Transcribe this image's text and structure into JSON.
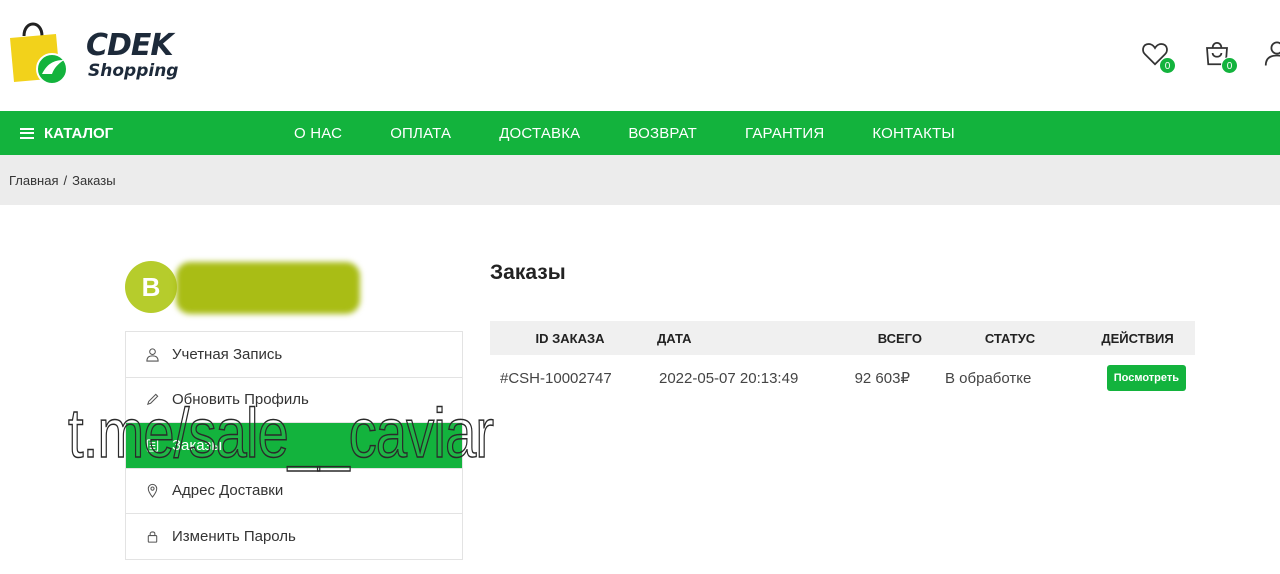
{
  "brand": {
    "name": "CDEK",
    "sub": "Shopping",
    "colors": {
      "primary": "#13b33d",
      "bag": "#f2d21b",
      "avatar": "#b6cc2c"
    }
  },
  "header": {
    "wishlist_count": "0",
    "cart_count": "0",
    "icons": [
      "heart-icon",
      "bag-icon",
      "user-icon"
    ]
  },
  "nav": {
    "catalog_label": "КАТАЛОГ",
    "items": [
      "О НАС",
      "ОПЛАТА",
      "ДОСТАВКА",
      "ВОЗВРАТ",
      "ГАРАНТИЯ",
      "КОНТАКТЫ"
    ]
  },
  "breadcrumb": {
    "home": "Главная",
    "separator": "/",
    "current": "Заказы"
  },
  "profile": {
    "avatar_letter": "B"
  },
  "sidebar": {
    "items": [
      {
        "label": "Учетная Запись",
        "icon": "user-icon"
      },
      {
        "label": "Обновить Профиль",
        "icon": "pencil-icon"
      },
      {
        "label": "Заказы",
        "icon": "list-icon",
        "active": true
      },
      {
        "label": "Адрес Доставки",
        "icon": "location-icon"
      },
      {
        "label": "Изменить Пароль",
        "icon": "lock-icon"
      }
    ]
  },
  "orders": {
    "title": "Заказы",
    "columns": [
      "ID ЗАКАЗА",
      "ДАТА",
      "ВСЕГО",
      "СТАТУС",
      "ДЕЙСТВИЯ"
    ],
    "rows": [
      {
        "id": "#CSH-10002747",
        "date": "2022-05-07 20:13:49",
        "total": "92 603₽",
        "status": "В обработке",
        "action": "Посмотреть"
      }
    ]
  },
  "watermark": "t.me/sale__caviar"
}
